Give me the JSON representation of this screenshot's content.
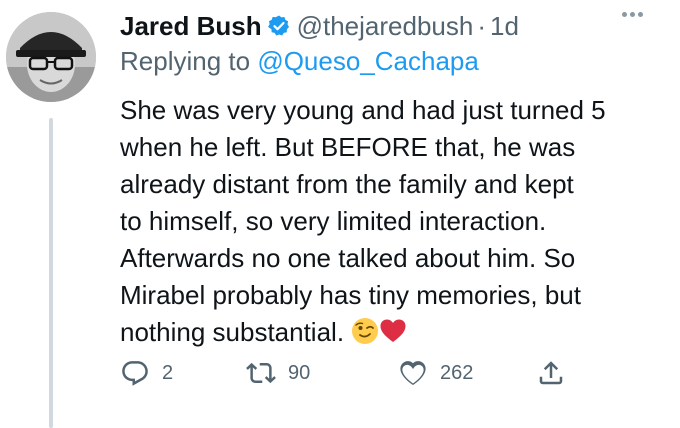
{
  "tweet": {
    "display_name": "Jared Bush",
    "handle": "@thejaredbush",
    "separator": "·",
    "timestamp": "1d",
    "verified": true,
    "replying_prefix": "Replying to",
    "replying_to": "@Queso_Cachapa",
    "text": "She was very young and had just turned 5\nwhen he left. But BEFORE that, he was\nalready distant from the family and kept\nto himself, so very limited interaction.\nAfterwards no one talked about him. So\nMirabel probably has tiny memories, but\nnothing substantial.",
    "emojis": [
      "winking-face",
      "red-heart"
    ]
  },
  "actions": {
    "reply_count": "2",
    "retweet_count": "90",
    "like_count": "262"
  },
  "colors": {
    "text": "#0f1419",
    "secondary": "#536471",
    "link": "#1d9bf0",
    "verified": "#1d9bf0",
    "thread_line": "#cfd9de"
  },
  "icons": [
    "verified-badge-icon",
    "more-options-icon",
    "reply-icon",
    "retweet-icon",
    "like-icon",
    "share-icon"
  ]
}
